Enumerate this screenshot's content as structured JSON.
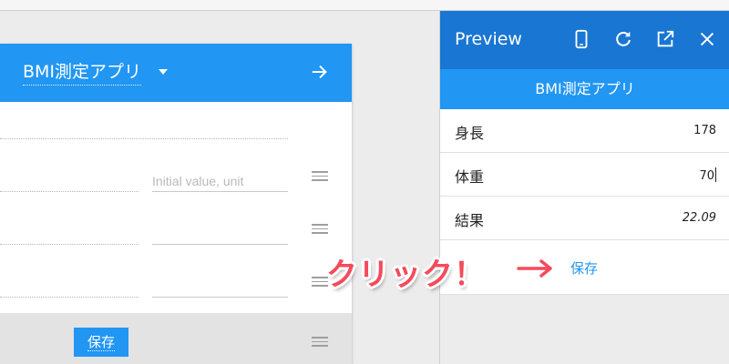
{
  "editor": {
    "app_title": "BMI測定アプリ",
    "placeholder": "Initial value, unit",
    "save_label": "保存"
  },
  "preview": {
    "title": "Preview",
    "toolbar_icons": [
      "phone-icon",
      "refresh-icon",
      "open-external-icon",
      "close-icon"
    ],
    "app_title": "BMI測定アプリ",
    "rows": [
      {
        "label": "身長",
        "value": "178"
      },
      {
        "label": "体重",
        "value": "70"
      },
      {
        "label": "結果",
        "value": "22.09"
      }
    ],
    "save_label": "保存"
  },
  "annotation": {
    "text": "クリック！"
  },
  "colors": {
    "editor_header": "#2196f3",
    "preview_bar": "#1976d2",
    "preview_appbar": "#2196f3",
    "annotation_red": "#f44b5b"
  }
}
